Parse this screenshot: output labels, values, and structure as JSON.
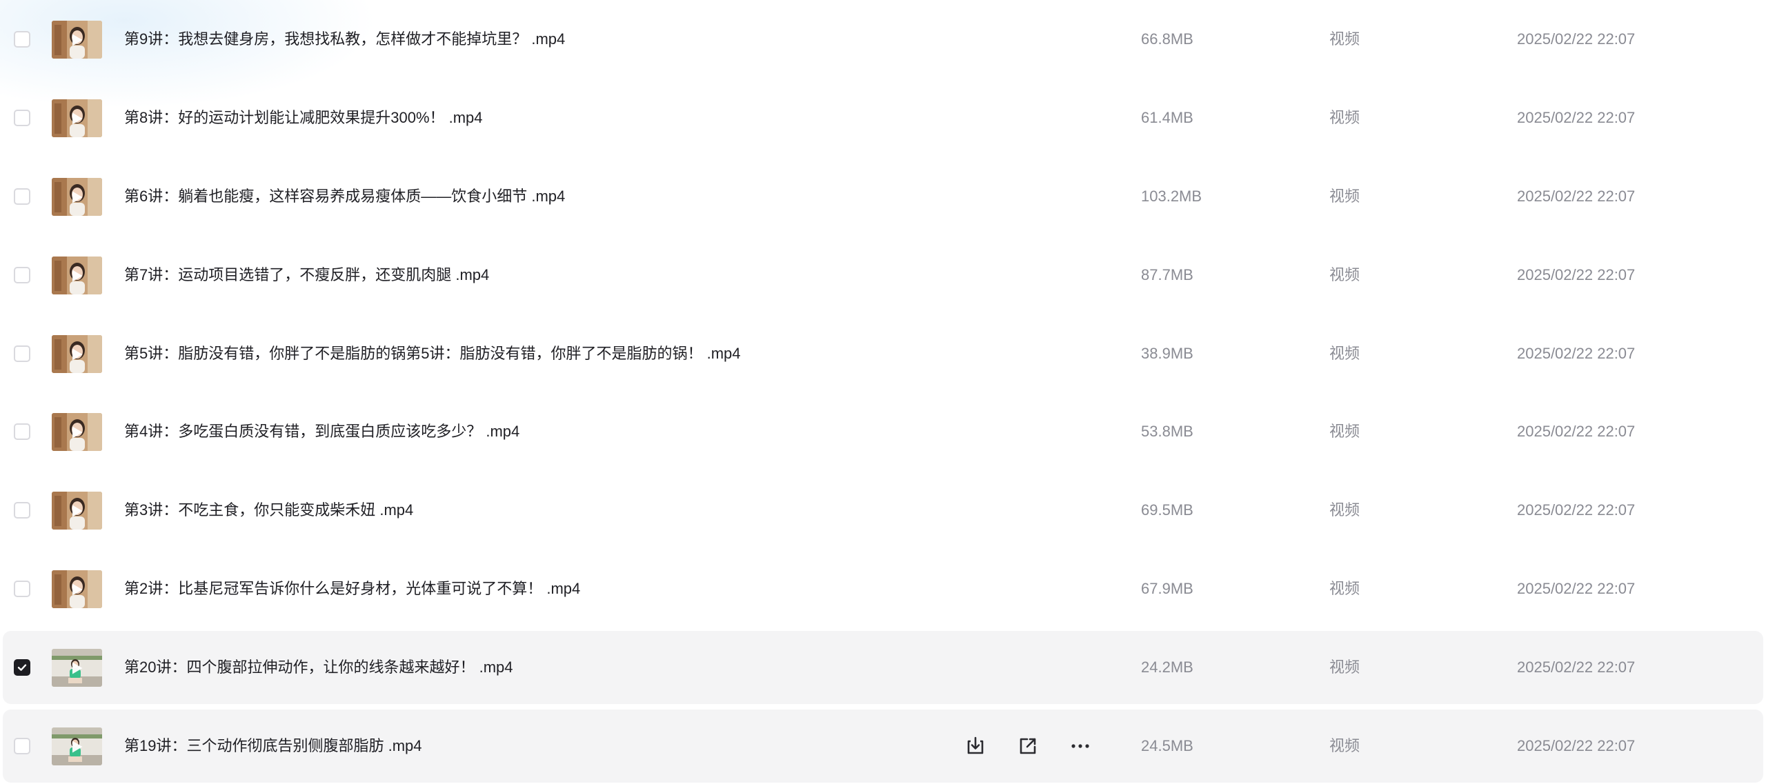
{
  "file_list": {
    "items": [
      {
        "name": "第9讲：我想去健身房，我想找私教，怎样做才不能掉坑里？ .mp4",
        "size": "66.8MB",
        "type": "视频",
        "modified": "2025/02/22 22:07",
        "checked": false,
        "thumbnail": "video-thumbnail-warm"
      },
      {
        "name": "第8讲：好的运动计划能让减肥效果提升300%！ .mp4",
        "size": "61.4MB",
        "type": "视频",
        "modified": "2025/02/22 22:07",
        "checked": false,
        "thumbnail": "video-thumbnail-warm"
      },
      {
        "name": "第6讲：躺着也能瘦，这样容易养成易瘦体质——饮食小细节 .mp4",
        "size": "103.2MB",
        "type": "视频",
        "modified": "2025/02/22 22:07",
        "checked": false,
        "thumbnail": "video-thumbnail-warm"
      },
      {
        "name": "第7讲：运动项目选错了，不瘦反胖，还变肌肉腿 .mp4",
        "size": "87.7MB",
        "type": "视频",
        "modified": "2025/02/22 22:07",
        "checked": false,
        "thumbnail": "video-thumbnail-warm"
      },
      {
        "name": "第5讲：脂肪没有错，你胖了不是脂肪的锅第5讲：脂肪没有错，你胖了不是脂肪的锅！ .mp4",
        "size": "38.9MB",
        "type": "视频",
        "modified": "2025/02/22 22:07",
        "checked": false,
        "thumbnail": "video-thumbnail-warm"
      },
      {
        "name": "第4讲：多吃蛋白质没有错，到底蛋白质应该吃多少？ .mp4",
        "size": "53.8MB",
        "type": "视频",
        "modified": "2025/02/22 22:07",
        "checked": false,
        "thumbnail": "video-thumbnail-warm"
      },
      {
        "name": "第3讲：不吃主食，你只能变成柴禾妞 .mp4",
        "size": "69.5MB",
        "type": "视频",
        "modified": "2025/02/22 22:07",
        "checked": false,
        "thumbnail": "video-thumbnail-warm"
      },
      {
        "name": "第2讲：比基尼冠军告诉你什么是好身材，光体重可说了不算！ .mp4",
        "size": "67.9MB",
        "type": "视频",
        "modified": "2025/02/22 22:07",
        "checked": false,
        "thumbnail": "video-thumbnail-warm"
      },
      {
        "name": "第20讲：四个腹部拉伸动作，让你的线条越来越好！ .mp4",
        "size": "24.2MB",
        "type": "视频",
        "modified": "2025/02/22 22:07",
        "checked": true,
        "thumbnail": "video-thumbnail-gym"
      },
      {
        "name": "第19讲：三个动作彻底告别侧腹部脂肪 .mp4",
        "size": "24.5MB",
        "type": "视频",
        "modified": "2025/02/22 22:07",
        "checked": false,
        "thumbnail": "video-thumbnail-gym",
        "hovered": true
      }
    ],
    "hover_actions": [
      {
        "icon": "download-icon",
        "name": "download-button"
      },
      {
        "icon": "share-icon",
        "name": "share-button"
      },
      {
        "icon": "more-icon",
        "name": "more-button"
      }
    ]
  },
  "colors": {
    "row_highlight": "#f4f4f5",
    "text_primary": "#1f1f24",
    "text_secondary": "#8a8b93",
    "checkbox_checked": "#1d1d22",
    "checkbox_border": "#d9d9de"
  }
}
